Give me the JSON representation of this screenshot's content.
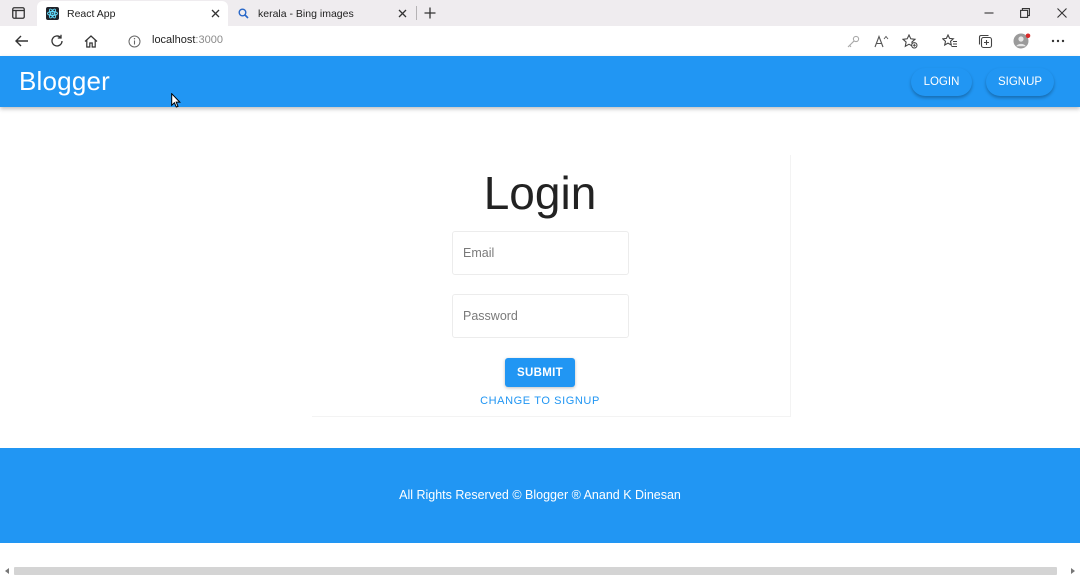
{
  "browser": {
    "tabs": [
      {
        "title": "React App",
        "favicon": "react-icon",
        "active": true
      },
      {
        "title": "kerala - Bing images",
        "favicon": "search-icon",
        "active": false
      }
    ],
    "address": {
      "host": "localhost",
      "port": ":3000"
    }
  },
  "app": {
    "brand": "Blogger",
    "nav": {
      "login": "LOGIN",
      "signup": "SIGNUP"
    },
    "accent_color": "#2196f3"
  },
  "login": {
    "title": "Login",
    "email_placeholder": "Email",
    "password_placeholder": "Password",
    "submit_label": "SUBMIT",
    "switch_label": "CHANGE TO SIGNUP"
  },
  "footer": {
    "text": "All Rights Reserved © Blogger ® Anand K Dinesan"
  }
}
